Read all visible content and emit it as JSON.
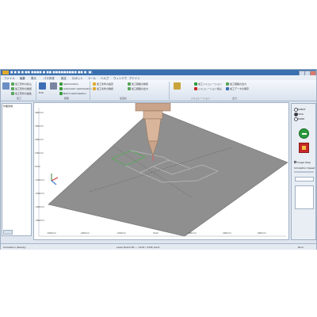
{
  "window": {
    "title": "■ ■ ■ ■ ■■ ■■■■ ■ ■■ ■■■■■■■■■ ■■ ■ (■)"
  },
  "menu": {
    "items": [
      "ファイル",
      "編集",
      "表示",
      "パス作成",
      "設定",
      "ロボット",
      "ツール",
      "ヘルプ",
      "ウィンドウ",
      "アドイン"
    ]
  },
  "ribbon": {
    "left_items": [
      "加工形状の読込",
      "加工形状の確認",
      "加工形状の編集"
    ],
    "buttons": [
      {
        "label": "Edit",
        "icon_color": "#3d6fb5"
      },
      {
        "label": "Optimization",
        "icon_color": "#3c9a3c"
      },
      {
        "label": "Automatic Optimization",
        "icon_color": "#3c9a3c"
      },
      {
        "label": "Batch Optimization",
        "icon_color": "#3c9a3c"
      }
    ],
    "mid_items": [
      "加工条件の設定",
      "加工条件の確認",
      "加工経路の確認",
      "加工経路の出力"
    ],
    "right_items": [
      "加工シミュレーション",
      "シミュレーション停止",
      "加工経路の出力",
      "加工データの保存"
    ],
    "groups": [
      "加工",
      "経路",
      "最適化",
      "シミュレーション",
      "出力"
    ]
  },
  "left_panel": {
    "header": "作業領域"
  },
  "viewport": {
    "plate_color": "#8f8f8f",
    "path_color": "#4caf50",
    "x_ticks": [
      "-600mm",
      "-400mm",
      "-200mm",
      "0mm",
      "200mm",
      "400mm",
      "600mm"
    ],
    "y_ticks": [
      "400mm",
      "300mm",
      "200mm",
      "100mm",
      "0mm",
      "-100mm",
      "-200mm",
      "-300mm",
      "-400mm"
    ]
  },
  "right_panel": {
    "radios": [
      "ROBOT",
      "TOOL",
      "WORK"
    ],
    "checkbox": "Single Step",
    "simulation_speed": "Simulation Speed",
    "play_color": "#2c9a3c",
    "stop_color": "#c62828"
  },
  "status": {
    "left": "Simulation (Ready)",
    "center": "Laser Robot RV — 1234 / 2345 point",
    "right": "Num"
  }
}
